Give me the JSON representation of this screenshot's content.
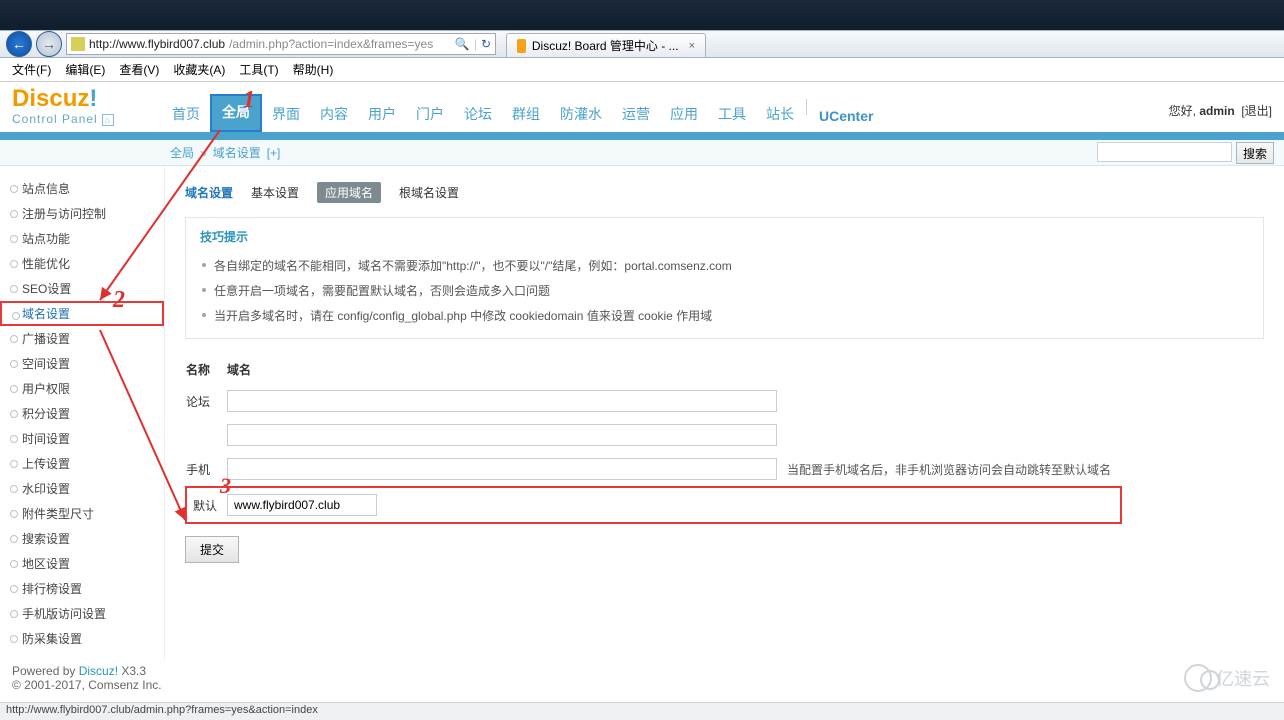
{
  "browser": {
    "url_prefix": "http://www.flybird007.club",
    "url_suffix": "/admin.php?action=index&frames=yes",
    "search_glyph": "🔍",
    "refresh_glyph": "↻",
    "tab_title": "Discuz! Board 管理中心 - ...",
    "tab_close": "×",
    "menus": [
      "文件(F)",
      "编辑(E)",
      "查看(V)",
      "收藏夹(A)",
      "工具(T)",
      "帮助(H)"
    ]
  },
  "header": {
    "logo_main": "Discuz",
    "logo_bang": "!",
    "logo_sub": "Control Panel",
    "nav": [
      "首页",
      "全局",
      "界面",
      "内容",
      "用户",
      "门户",
      "论坛",
      "群组",
      "防灌水",
      "运营",
      "应用",
      "工具",
      "站长",
      "UCenter"
    ],
    "nav_selected": 1,
    "greeting_prefix": "您好, ",
    "greeting_user": "admin",
    "logout": "[退出]"
  },
  "breadcrumb": {
    "root": "全局",
    "arrow": "»",
    "current": "域名设置",
    "plus": "[+]",
    "search_btn": "搜索"
  },
  "sidebar": {
    "items": [
      "站点信息",
      "注册与访问控制",
      "站点功能",
      "性能优化",
      "SEO设置",
      "域名设置",
      "广播设置",
      "空间设置",
      "用户权限",
      "积分设置",
      "时间设置",
      "上传设置",
      "水印设置",
      "附件类型尺寸",
      "搜索设置",
      "地区设置",
      "排行榜设置",
      "手机版访问设置",
      "防采集设置"
    ],
    "active_index": 5
  },
  "subtabs": {
    "items": [
      "域名设置",
      "基本设置",
      "应用域名",
      "根域名设置"
    ],
    "current": 0,
    "pill": 2
  },
  "tips": {
    "title": "技巧提示",
    "lines": [
      "各自绑定的域名不能相同，域名不需要添加\"http://\"，也不要以\"/\"结尾，例如：portal.comsenz.com",
      "任意开启一项域名，需要配置默认域名，否则会造成多入口问题",
      "当开启多域名时，请在 config/config_global.php 中修改 cookiedomain 值来设置 cookie 作用域"
    ]
  },
  "form": {
    "head_name": "名称",
    "head_domain": "域名",
    "rows": [
      {
        "label": "论坛",
        "value": ""
      },
      {
        "label": "",
        "value": ""
      },
      {
        "label": "手机",
        "value": "",
        "note": "当配置手机域名后，非手机浏览器访问会自动跳转至默认域名"
      },
      {
        "label": "默认",
        "value": "www.flybird007.club"
      }
    ],
    "submit": "提交"
  },
  "footer": {
    "line1_a": "Powered by ",
    "line1_link": "Discuz!",
    "line1_b": " X3.3",
    "line2": "© 2001-2017, Comsenz Inc."
  },
  "statusbar": "http://www.flybird007.club/admin.php?frames=yes&action=index",
  "watermark": "亿速云",
  "annotations": {
    "n1": "1",
    "n2": "2",
    "n3": "3"
  }
}
